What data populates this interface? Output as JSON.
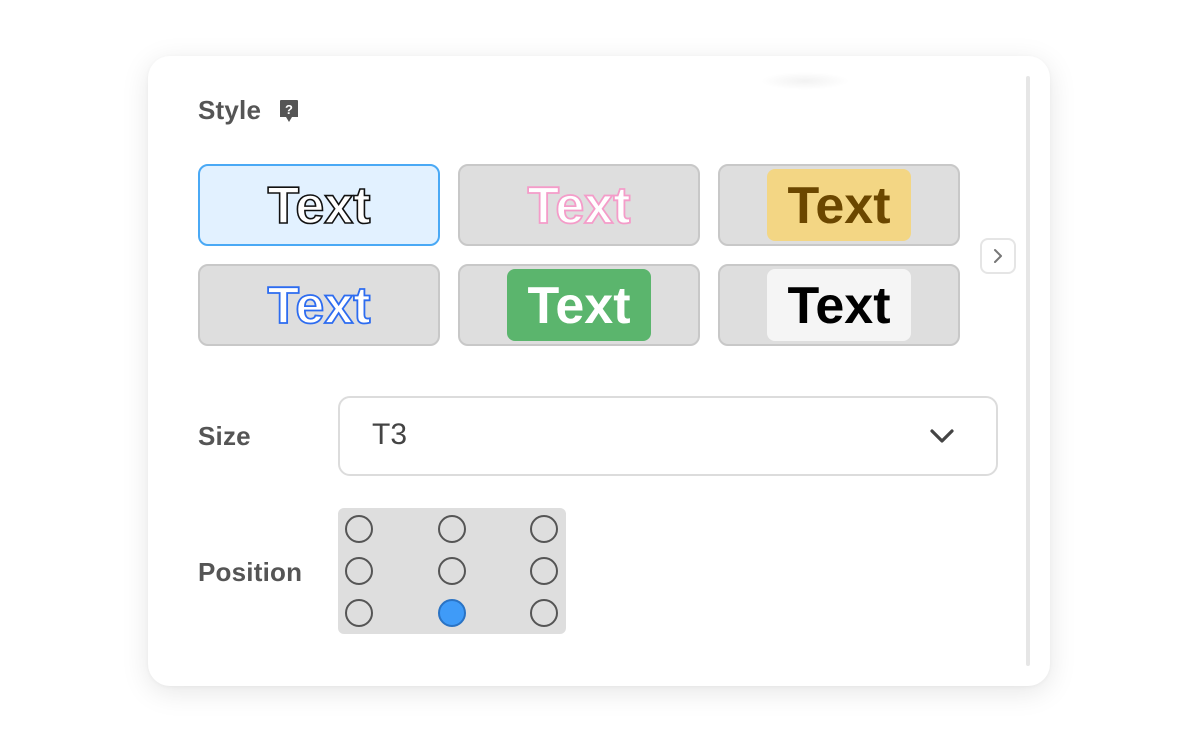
{
  "style_section": {
    "label": "Style",
    "help_icon": "question-mark-icon",
    "presets": [
      {
        "text": "Text",
        "variant": "outline-black",
        "selected": true
      },
      {
        "text": "Text",
        "variant": "outline-pink",
        "selected": false
      },
      {
        "text": "Text",
        "variant": "brown-on-yellow",
        "selected": false
      },
      {
        "text": "Text",
        "variant": "outline-blue",
        "selected": false
      },
      {
        "text": "Text",
        "variant": "white-on-green",
        "selected": false
      },
      {
        "text": "Text",
        "variant": "black-on-white",
        "selected": false
      }
    ],
    "next_icon": "chevron-right-icon"
  },
  "size_section": {
    "label": "Size",
    "value": "T3",
    "dropdown_icon": "chevron-down-icon"
  },
  "position_section": {
    "label": "Position",
    "selected": {
      "row": 3,
      "col": 2
    }
  },
  "colors": {
    "selected_tile_bg": "#e2f1ff",
    "selected_tile_border": "#4aa9f5",
    "tile_bg": "#dedede",
    "yellow_badge": "#f3d684",
    "brown_text": "#6b4700",
    "green_badge": "#5bb56d",
    "pink_outline": "#f49cc9",
    "blue_outline": "#2d6cf0",
    "radio_checked": "#3f9bf8"
  }
}
